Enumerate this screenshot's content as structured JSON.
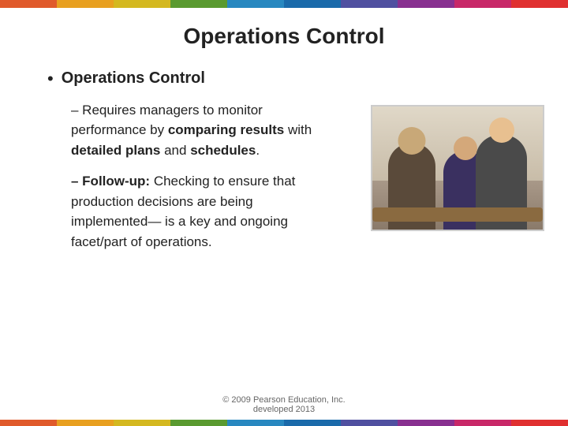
{
  "topbar": {
    "segments": [
      {
        "color": "#e05a2b"
      },
      {
        "color": "#e8a020"
      },
      {
        "color": "#d4b820"
      },
      {
        "color": "#5a9a30"
      },
      {
        "color": "#2888c0"
      },
      {
        "color": "#1a6aaa"
      },
      {
        "color": "#5050a0"
      },
      {
        "color": "#883090"
      },
      {
        "color": "#c82868"
      },
      {
        "color": "#e03030"
      }
    ]
  },
  "slide": {
    "title": "Operations Control",
    "main_bullet": "Operations Control",
    "sub_bullet_1_prefix": "– Requires managers to monitor performance by ",
    "sub_bullet_1_bold1": "comparing results",
    "sub_bullet_1_mid": " with ",
    "sub_bullet_1_bold2": "detailed plans",
    "sub_bullet_1_end": " and ",
    "sub_bullet_1_bold3": "schedules",
    "sub_bullet_1_final": ".",
    "sub_bullet_2_bold": "Follow-up:",
    "sub_bullet_2_text": " Checking to ensure that production decisions are being implemented— is a key and ongoing facet/part of operations."
  },
  "footer": {
    "line1": "© 2009 Pearson Education, Inc.",
    "line2": "developed 2013"
  }
}
